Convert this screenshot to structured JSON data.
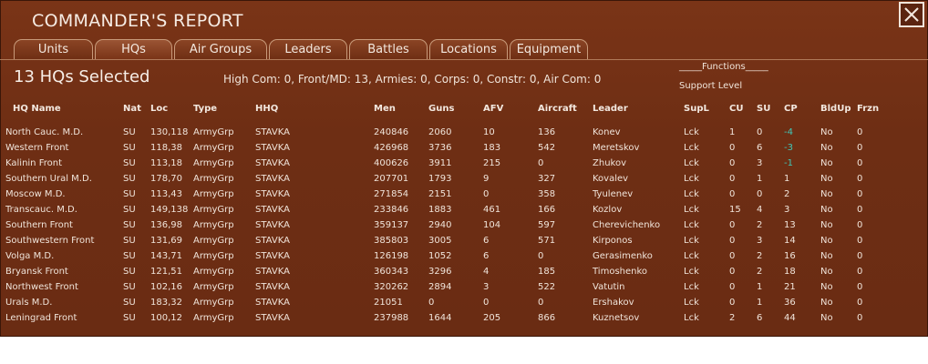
{
  "window": {
    "title": "COMMANDER'S REPORT"
  },
  "tabs": [
    {
      "label": "Units",
      "active": false
    },
    {
      "label": "HQs",
      "active": true
    },
    {
      "label": "Air Groups",
      "active": false
    },
    {
      "label": "Leaders",
      "active": false
    },
    {
      "label": "Battles",
      "active": false
    },
    {
      "label": "Locations",
      "active": false
    },
    {
      "label": "Equipment",
      "active": false
    }
  ],
  "selection": {
    "count_text": "13 HQs Selected",
    "summary": "High Com: 0, Front/MD: 13, Armies: 0, Corps: 0, Constr: 0, Air Com: 0"
  },
  "legend": {
    "functions": "_____Functions_____",
    "support_level": "Support Level"
  },
  "columns": [
    "HQ Name",
    "Nat",
    "Loc",
    "Type",
    "HHQ",
    "Men",
    "Guns",
    "AFV",
    "Aircraft",
    "Leader",
    "SupL",
    "CU",
    "SU",
    "CP",
    "BldUp",
    "Frzn"
  ],
  "rows": [
    [
      "North Cauc. M.D.",
      "SU",
      "130,118",
      "ArmyGrp",
      "STAVKA",
      "240846",
      "2060",
      "10",
      "136",
      "Konev",
      "Lck",
      "1",
      "0",
      "-4",
      "No",
      "0"
    ],
    [
      "Western Front",
      "SU",
      "118,38",
      "ArmyGrp",
      "STAVKA",
      "426968",
      "3736",
      "183",
      "542",
      "Meretskov",
      "Lck",
      "0",
      "6",
      "-3",
      "No",
      "0"
    ],
    [
      "Kalinin Front",
      "SU",
      "113,18",
      "ArmyGrp",
      "STAVKA",
      "400626",
      "3911",
      "215",
      "0",
      "Zhukov",
      "Lck",
      "0",
      "3",
      "-1",
      "No",
      "0"
    ],
    [
      "Southern Ural M.D.",
      "SU",
      "178,70",
      "ArmyGrp",
      "STAVKA",
      "207701",
      "1793",
      "9",
      "327",
      "Kovalev",
      "Lck",
      "0",
      "1",
      "1",
      "No",
      "0"
    ],
    [
      "Moscow M.D.",
      "SU",
      "113,43",
      "ArmyGrp",
      "STAVKA",
      "271854",
      "2151",
      "0",
      "358",
      "Tyulenev",
      "Lck",
      "0",
      "0",
      "2",
      "No",
      "0"
    ],
    [
      "Transcauc. M.D.",
      "SU",
      "149,138",
      "ArmyGrp",
      "STAVKA",
      "233846",
      "1883",
      "461",
      "166",
      "Kozlov",
      "Lck",
      "15",
      "4",
      "3",
      "No",
      "0"
    ],
    [
      "Southern Front",
      "SU",
      "136,98",
      "ArmyGrp",
      "STAVKA",
      "359137",
      "2940",
      "104",
      "597",
      "Cherevichenko",
      "Lck",
      "0",
      "2",
      "13",
      "No",
      "0"
    ],
    [
      "Southwestern Front",
      "SU",
      "131,69",
      "ArmyGrp",
      "STAVKA",
      "385803",
      "3005",
      "6",
      "571",
      "Kirponos",
      "Lck",
      "0",
      "3",
      "14",
      "No",
      "0"
    ],
    [
      "Volga M.D.",
      "SU",
      "143,71",
      "ArmyGrp",
      "STAVKA",
      "126198",
      "1052",
      "6",
      "0",
      "Gerasimenko",
      "Lck",
      "0",
      "2",
      "16",
      "No",
      "0"
    ],
    [
      "Bryansk Front",
      "SU",
      "121,51",
      "ArmyGrp",
      "STAVKA",
      "360343",
      "3296",
      "4",
      "185",
      "Timoshenko",
      "Lck",
      "0",
      "2",
      "18",
      "No",
      "0"
    ],
    [
      "Northwest Front",
      "SU",
      "102,16",
      "ArmyGrp",
      "STAVKA",
      "320262",
      "2894",
      "3",
      "522",
      "Vatutin",
      "Lck",
      "0",
      "1",
      "21",
      "No",
      "0"
    ],
    [
      "Urals M.D.",
      "SU",
      "183,32",
      "ArmyGrp",
      "STAVKA",
      "21051",
      "0",
      "0",
      "0",
      "Ershakov",
      "Lck",
      "0",
      "1",
      "36",
      "No",
      "0"
    ],
    [
      "Leningrad Front",
      "SU",
      "100,12",
      "ArmyGrp",
      "STAVKA",
      "237988",
      "1644",
      "205",
      "866",
      "Kuznetsov",
      "Lck",
      "2",
      "6",
      "44",
      "No",
      "0"
    ]
  ],
  "colors": {
    "panel_bg": "#6e2e14",
    "text": "#f0e4da",
    "negative_cp": "#3fc8b8"
  },
  "icons": {
    "close": "close-icon"
  }
}
